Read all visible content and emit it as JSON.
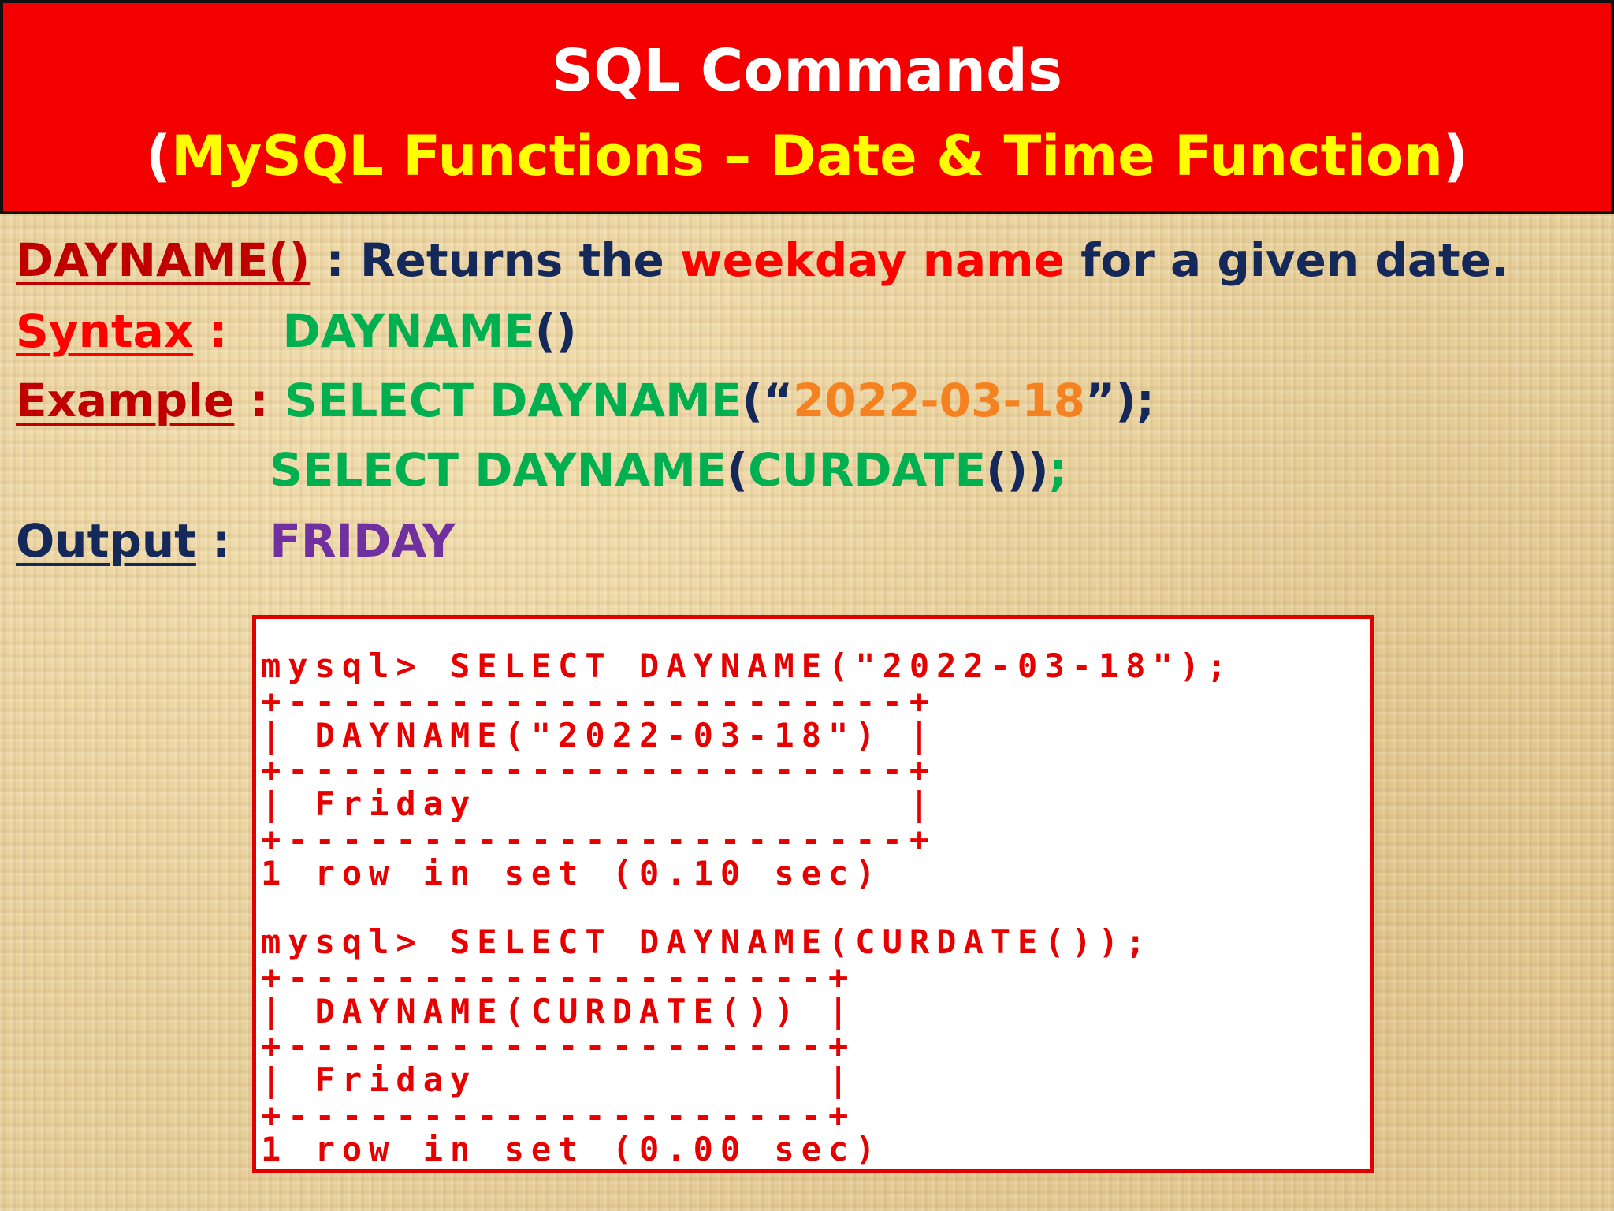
{
  "banner": {
    "title": "SQL Commands",
    "subtitle_open": "(",
    "subtitle_text": "MySQL Functions – Date & Time Function",
    "subtitle_close": ")"
  },
  "definition": {
    "function": "DAYNAME()",
    "sep": " : ",
    "text_before": "Returns the ",
    "highlight": "weekday name",
    "text_after": " for a given date."
  },
  "syntax": {
    "label": "Syntax",
    "sep": " :",
    "func": "DAYNAME",
    "parens": "()"
  },
  "example": {
    "label": "Example",
    "sep": " : ",
    "line1_func": "SELECT DAYNAME",
    "line1_open": "(“",
    "line1_arg": "2022-03-18",
    "line1_close": "”);",
    "line2_func": "SELECT DAYNAME",
    "line2_open": "(",
    "line2_arg": "CURDATE",
    "line2_parens": "())",
    "line2_semi": ";"
  },
  "output": {
    "label": "Output",
    "sep": " :",
    "value": "FRIDAY"
  },
  "console": {
    "lines": [
      "mysql> SELECT DAYNAME(\"2022-03-18\");",
      "+-----------------------+",
      "| DAYNAME(\"2022-03-18\") |",
      "+-----------------------+",
      "| Friday                |",
      "+-----------------------+",
      "1 row in set (0.10 sec)",
      "mysql> SELECT DAYNAME(CURDATE());",
      "+--------------------+",
      "| DAYNAME(CURDATE()) |",
      "+--------------------+",
      "| Friday             |",
      "+--------------------+",
      "1 row in set (0.00 sec)"
    ]
  },
  "colors": {
    "banner_bg": "#f50000",
    "title_white": "#ffffff",
    "subtitle_yellow": "#ffff00",
    "dark_red": "#c00000",
    "red": "#ff0000",
    "navy": "#14285a",
    "green": "#00b050",
    "orange": "#f58220",
    "purple": "#7030a0",
    "console_text": "#e60000"
  }
}
